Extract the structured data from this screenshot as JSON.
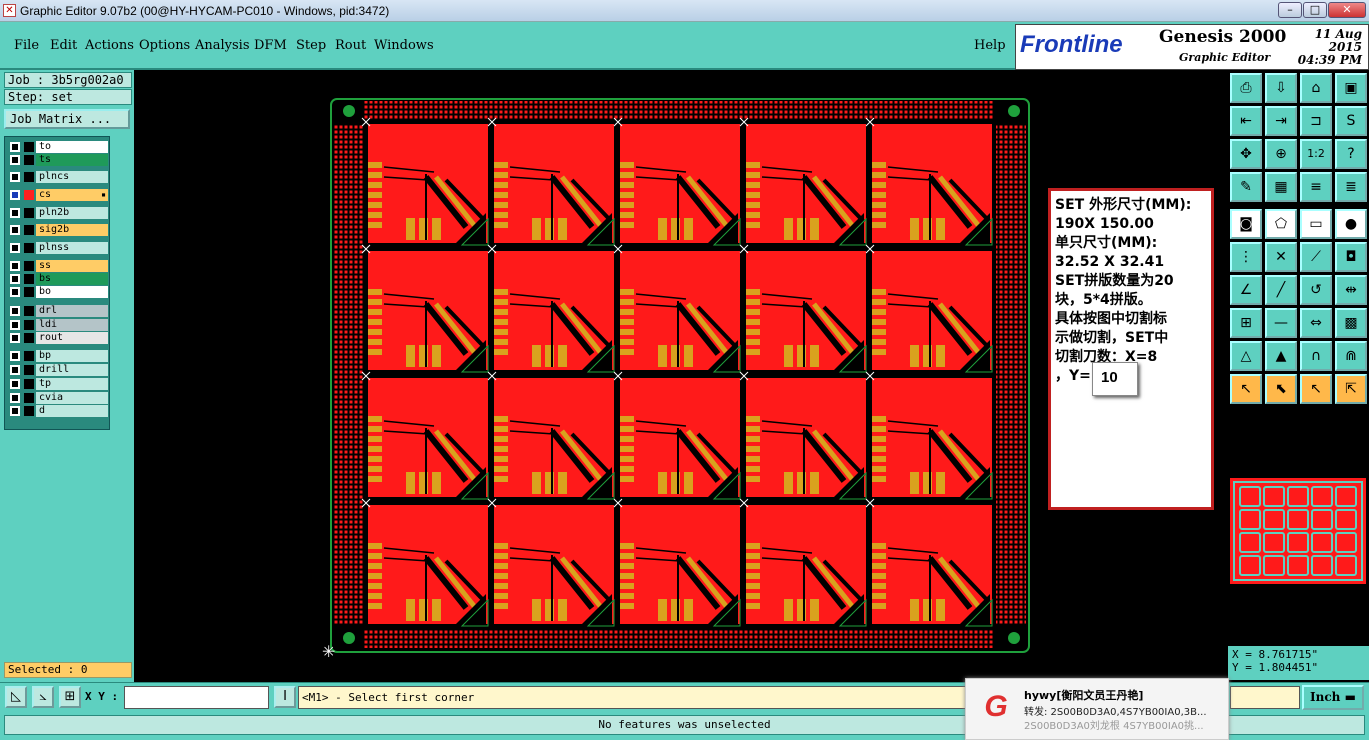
{
  "window": {
    "title": "Graphic Editor 9.07b2 (00@HY-HYCAM-PC010 - Windows, pid:3472)",
    "controls": {
      "minimize": "–",
      "maximize": "□",
      "close": "✕"
    }
  },
  "menu": {
    "items": [
      "File",
      "Edit",
      "Actions",
      "Options",
      "Analysis",
      "DFM",
      "Step",
      "Rout",
      "Windows"
    ],
    "help": "Help"
  },
  "logo": {
    "brand": "Frontline",
    "product": "Genesis 2000",
    "subtitle": "Graphic Editor",
    "date": "11 Aug 2015",
    "time": "04:39 PM"
  },
  "job": {
    "job_label": "Job : 3b5rg002a0",
    "step_label": "Step: set",
    "matrix_button": "Job Matrix ..."
  },
  "layers": [
    {
      "name": "to",
      "color": "#ffffff",
      "active": false
    },
    {
      "name": "ts",
      "color": "#1f9a5a",
      "active": false
    },
    {
      "name": "plncs",
      "color": "#bde8e0",
      "active": false
    },
    {
      "name": "cs",
      "color": "#ffcc66",
      "active": true
    },
    {
      "name": "pln2b",
      "color": "#bde8e0",
      "active": false
    },
    {
      "name": "sig2b",
      "color": "#ffcc66",
      "active": false
    },
    {
      "name": "plnss",
      "color": "#bde8e0",
      "active": false
    },
    {
      "name": "ss",
      "color": "#ffcc66",
      "active": false
    },
    {
      "name": "bs",
      "color": "#1f9a5a",
      "active": false
    },
    {
      "name": "bo",
      "color": "#ffffff",
      "active": false
    },
    {
      "name": "drl",
      "color": "#b4c4c8",
      "active": false
    },
    {
      "name": "ldi",
      "color": "#b4c4c8",
      "active": false
    },
    {
      "name": "rout",
      "color": "#e6e6e6",
      "active": false
    },
    {
      "name": "bp",
      "color": "#bde8e0",
      "active": false
    },
    {
      "name": "drill",
      "color": "#bde8e0",
      "active": false
    },
    {
      "name": "tp",
      "color": "#bde8e0",
      "active": false
    },
    {
      "name": "cvia",
      "color": "#bde8e0",
      "active": false
    },
    {
      "name": "d",
      "color": "#bde8e0",
      "active": false
    }
  ],
  "selected": "Selected : 0",
  "bottom": {
    "xy_label": "X Y :",
    "xy_value": "",
    "prompt": "<M1> - Select first corner",
    "unit": "Inch"
  },
  "status": "No features was unselected",
  "coordinates": {
    "x": "X = 8.761715\"",
    "y": "Y = 1.804451\""
  },
  "note": {
    "lines": [
      "SET 外形尺寸(MM):",
      "190X 150.00",
      "单只尺寸(MM):",
      "32.52 X 32.41",
      "SET拼版数量为20",
      "块，5*4拼版。",
      "具体按图中切割标",
      "示做切割，SET中",
      "切割刀数：X=8",
      "，Y="
    ],
    "callout": "10"
  },
  "notification": {
    "title": "hywy[衡阳文员王丹艳]",
    "line1": "转发: 2S00B0D3A0,4S7YB00IA0,3B...",
    "line2": "2S00B0D3A0刘龙根 4S7YB00IA0挑..."
  },
  "panel": {
    "cols": 5,
    "rows": 4
  },
  "colors": {
    "ui_teal": "#5ed0c0",
    "copper": "#ff1a1a",
    "pad": "#d9a21e",
    "outline": "#1fa03c",
    "note_border": "#c02020"
  },
  "tools": [
    "save-icon",
    "download-icon",
    "fit-icon",
    "window-icon",
    "pan-left-icon",
    "pan-right-icon",
    "zoom-home-icon",
    "snap-icon",
    "zoom-fit-icon",
    "zoom-in-icon",
    "scale-1-2-icon",
    "help-icon",
    "sketch-icon",
    "grid-icon",
    "layers-icon",
    "layers-alt-icon",
    "fill-icon",
    "shape-icon",
    "ruler-icon",
    "dot-icon",
    "connect-icon",
    "cross-icon",
    "snap-point-icon",
    "pad-icon",
    "angle-icon",
    "line-icon",
    "arc-icon",
    "mirror-icon",
    "move-icon",
    "minus-icon",
    "measure-icon",
    "select-box-icon",
    "triangle-icon",
    "triangle-alt-icon",
    "arch-icon",
    "arch-alt-icon",
    "pointer-icon",
    "pointer-box-icon",
    "pointer-alt-icon",
    "pointer-multi-icon"
  ]
}
